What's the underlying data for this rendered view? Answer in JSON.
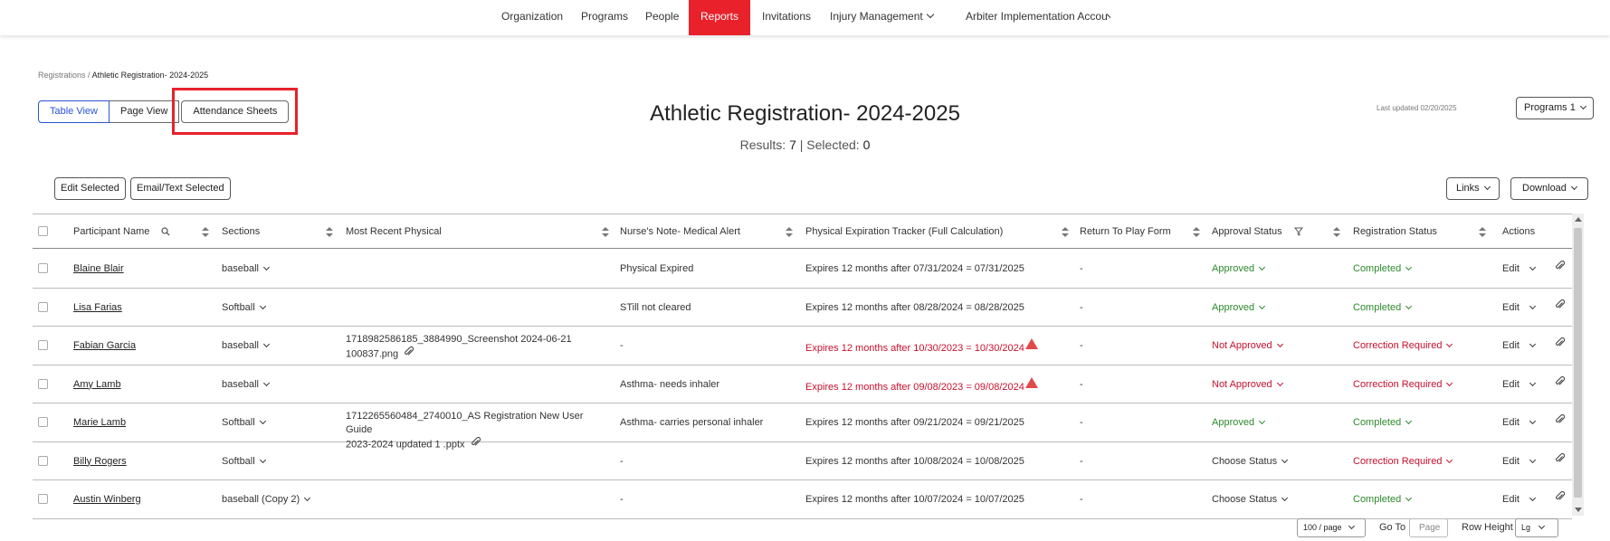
{
  "nav": {
    "organization": "Organization",
    "programs": "Programs",
    "people": "People",
    "reports": "Reports",
    "invitations": "Invitations",
    "injury_management": "Injury Management",
    "account": "Arbiter Implementation Accou"
  },
  "breadcrumb": {
    "parent": "Registrations",
    "separator": "/",
    "current": "Athletic Registration- 2024-2025"
  },
  "views": {
    "table": "Table View",
    "page": "Page View",
    "attendance": "Attendance Sheets"
  },
  "header": {
    "title": "Athletic Registration- 2024-2025",
    "results_label": "Results:",
    "results_count": "7",
    "selected_label": "| Selected:",
    "selected_count": "0",
    "last_updated": "Last updated 02/20/2025",
    "programs_btn": "Programs 1"
  },
  "toolbar": {
    "edit_selected": "Edit Selected",
    "email_selected": "Email/Text Selected",
    "links": "Links",
    "download": "Download"
  },
  "columns": {
    "participant": "Participant Name",
    "sections": "Sections",
    "physical": "Most Recent Physical",
    "nurse": "Nurse's Note- Medical Alert",
    "tracker": "Physical Expiration Tracker (Full Calculation)",
    "rtp": "Return To Play Form",
    "approval": "Approval Status",
    "registration": "Registration Status",
    "actions": "Actions"
  },
  "rows": [
    {
      "name": "Blaine Blair",
      "section": "baseball",
      "physical1": "",
      "physical2": "",
      "nurse": "Physical Expired",
      "tracker": "Expires 12 months after 07/31/2024 = 07/31/2025",
      "rtp": "-",
      "approval": "Approved",
      "registration": "Completed",
      "action": "Edit"
    },
    {
      "name": "Lisa Farias",
      "section": "Softball",
      "physical1": "",
      "physical2": "",
      "nurse": "STill not cleared",
      "tracker": "Expires 12 months after 08/28/2024 = 08/28/2025",
      "rtp": "-",
      "approval": "Approved",
      "registration": "Completed",
      "action": "Edit"
    },
    {
      "name": "Fabian Garcia",
      "section": "baseball",
      "physical1": "1718982586185_3884990_Screenshot 2024-06-21",
      "physical2": "100837.png",
      "nurse": "-",
      "tracker": "Expires 12 months after 10/30/2023 = 10/30/2024",
      "rtp": "-",
      "approval": "Not Approved",
      "registration": "Correction Required",
      "action": "Edit"
    },
    {
      "name": "Amy Lamb",
      "section": "baseball",
      "physical1": "",
      "physical2": "",
      "nurse": "Asthma- needs inhaler",
      "tracker": "Expires 12 months after 09/08/2023 = 09/08/2024",
      "rtp": "-",
      "approval": "Not Approved",
      "registration": "Correction Required",
      "action": "Edit"
    },
    {
      "name": "Marie Lamb",
      "section": "Softball",
      "physical1": "1712265560484_2740010_AS Registration New User Guide",
      "physical2": "2023-2024 updated 1 .pptx",
      "nurse": "Asthma- carries personal inhaler",
      "tracker": "Expires 12 months after 09/21/2024 = 09/21/2025",
      "rtp": "-",
      "approval": "Approved",
      "registration": "Completed",
      "action": "Edit"
    },
    {
      "name": "Billy Rogers",
      "section": "Softball",
      "physical1": "",
      "physical2": "",
      "nurse": "-",
      "tracker": "Expires 12 months after 10/08/2024 = 10/08/2025",
      "rtp": "-",
      "approval": "Choose Status",
      "registration": "Correction Required",
      "action": "Edit"
    },
    {
      "name": "Austin Winberg",
      "section": "baseball (Copy 2)",
      "physical1": "",
      "physical2": "",
      "nurse": "-",
      "tracker": "Expires 12 months after 10/07/2024 = 10/07/2025",
      "rtp": "-",
      "approval": "Choose Status",
      "registration": "Completed",
      "action": "Edit"
    }
  ],
  "footer": {
    "per_page": "100 / page",
    "goto_label": "Go To",
    "page_placeholder": "Page",
    "row_height_label": "Row Height",
    "row_height_value": "Lg"
  },
  "colors": {
    "accent_red": "#e8212b",
    "link_blue": "#2a55d4",
    "status_green": "#2c8a2c",
    "status_red": "#c8102e"
  }
}
